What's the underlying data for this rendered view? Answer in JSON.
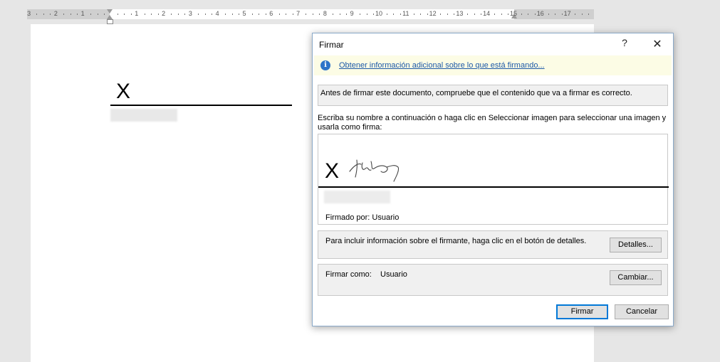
{
  "ruler": {
    "labels": [
      "3",
      "2",
      "1",
      "1",
      "2",
      "3",
      "4",
      "5",
      "6",
      "7",
      "8",
      "9",
      "10",
      "11",
      "12",
      "13",
      "14",
      "15",
      "16",
      "17"
    ]
  },
  "document": {
    "sig_x": "X"
  },
  "dialog": {
    "title": "Firmar",
    "help_label": "?",
    "close_label": "✕",
    "info_link": "Obtener información adicional sobre lo que está firmando...",
    "warning_text": "Antes de firmar este documento, compruebe que el contenido que va a firmar es correcto.",
    "instruction_text": "Escriba su nombre a continuación o haga clic en Seleccionar imagen para seleccionar una imagen y usarla como firma:",
    "sig_x": "X",
    "signed_by": "Firmado por: Usuario",
    "details_text": "Para incluir información sobre el firmante, haga clic en el botón de detalles.",
    "details_button": "Detalles...",
    "sign_as_label": "Firmar como:",
    "sign_as_value": "Usuario",
    "change_button": "Cambiar...",
    "sign_button": "Firmar",
    "cancel_button": "Cancelar"
  },
  "colors": {
    "accent": "#0078d7",
    "link": "#1e5aa8",
    "infobar": "#fcfce5"
  },
  "icons": [
    "info-icon",
    "help-icon",
    "close-icon"
  ]
}
